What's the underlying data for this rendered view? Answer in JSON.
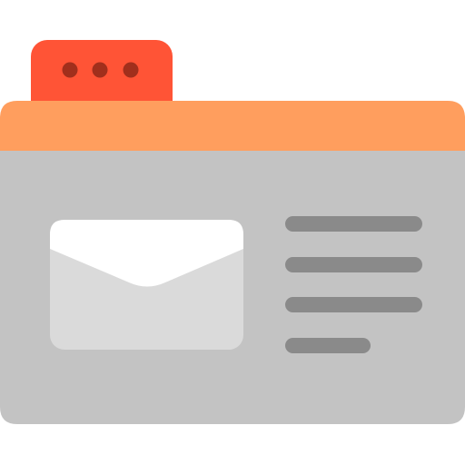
{
  "icon": {
    "name": "email-folder-icon",
    "colors": {
      "tab": "#FF5436",
      "tab_dots": "#A12F1C",
      "header_bar": "#FF9E5E",
      "body": "#C3C3C3",
      "envelope": "#DADADA",
      "envelope_flap": "#FFFFFF",
      "text_lines": "#8A8A8A"
    },
    "text_line_count": 4,
    "tab_dot_count": 3
  }
}
